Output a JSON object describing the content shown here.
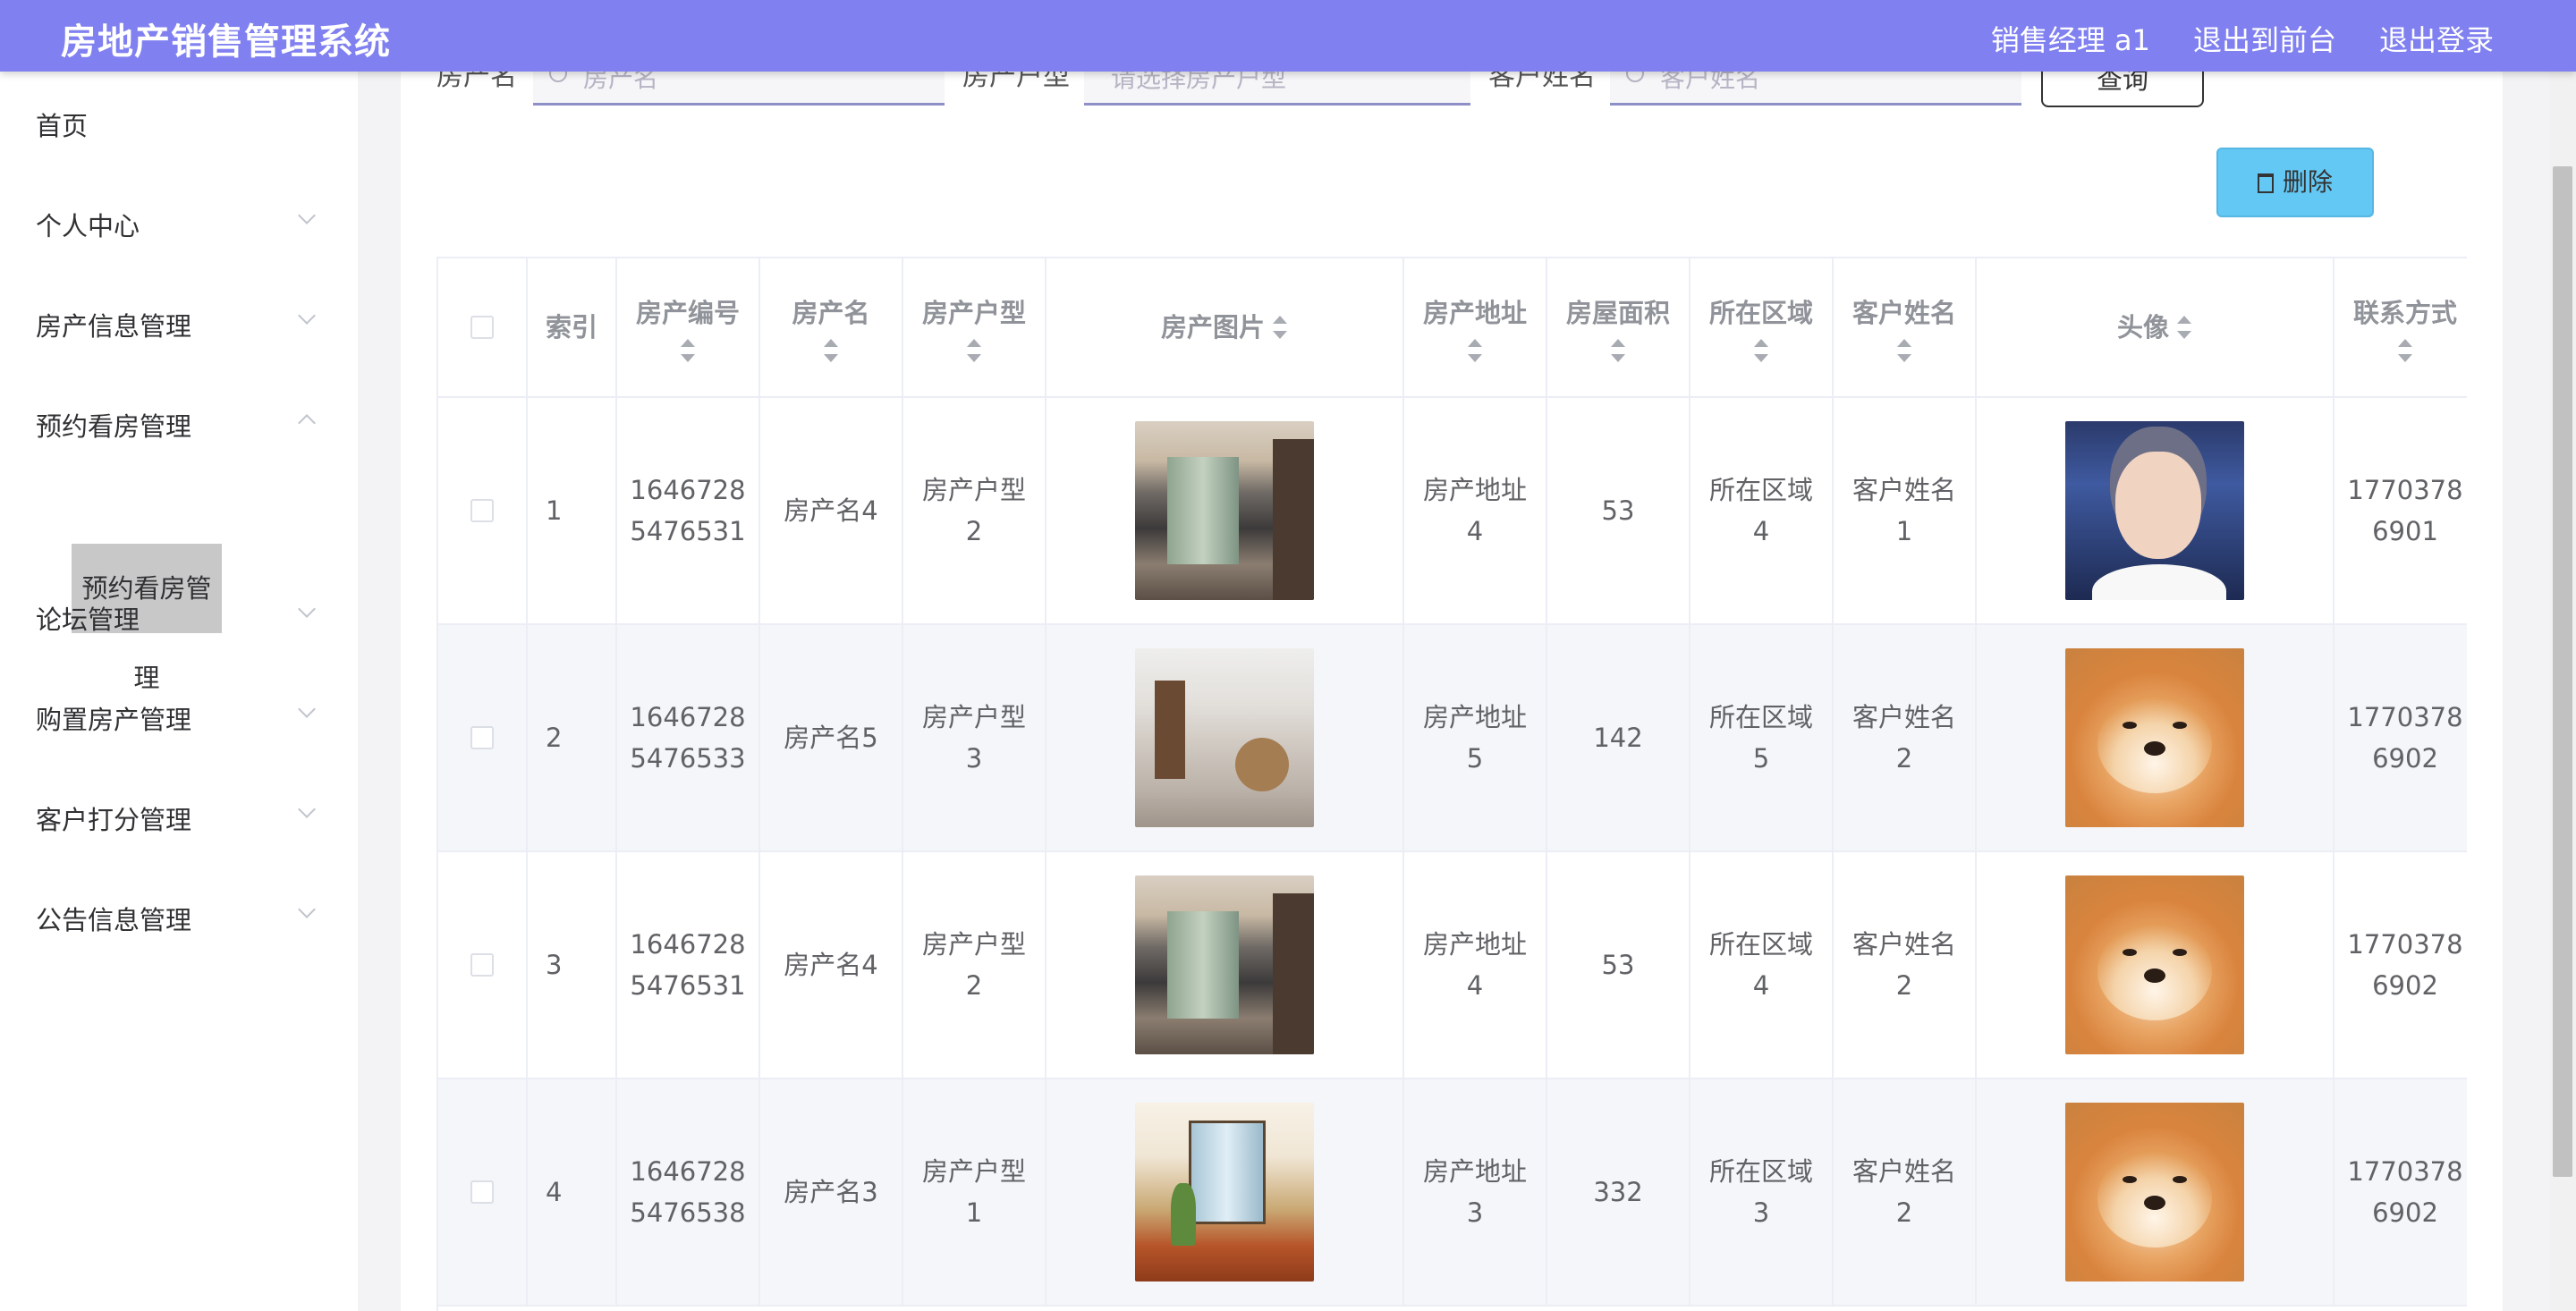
{
  "app": {
    "title": "房地产销售管理系统",
    "user_label": "销售经理 a1",
    "to_front": "退出到前台",
    "logout": "退出登录"
  },
  "sidebar": {
    "items": [
      {
        "label": "首页"
      },
      {
        "label": "个人中心"
      },
      {
        "label": "房产信息管理"
      },
      {
        "label": "预约看房管理"
      },
      {
        "label": "论坛管理"
      },
      {
        "label": "购置房产管理"
      },
      {
        "label": "客户打分管理"
      },
      {
        "label": "公告信息管理"
      }
    ],
    "active_sub": "预约看房管理"
  },
  "search": {
    "f1_label": "房产名",
    "f1_placeholder": "房产名",
    "f2_label": "房产户型",
    "f2_placeholder": "请选择房产户型",
    "f3_label": "客户姓名",
    "f3_placeholder": "客户姓名",
    "query_label": "查询"
  },
  "toolbar": {
    "delete_label": "删除"
  },
  "table": {
    "columns": [
      "索引",
      "房产编号",
      "房产名",
      "房产户型",
      "房产图片",
      "房产地址",
      "房屋面积",
      "所在区域",
      "客户姓名",
      "头像",
      "联系方式"
    ],
    "rows": [
      {
        "index": "1",
        "code_a": "1646728",
        "code_b": "5476531",
        "name": "房产名4",
        "type_a": "房产户型",
        "type_b": "2",
        "photo": "living-room",
        "addr_a": "房产地址",
        "addr_b": "4",
        "area": "53",
        "region_a": "所在区域",
        "region_b": "4",
        "cust_a": "客户姓名",
        "cust_b": "1",
        "avatar": "boy-portrait",
        "phone_a": "1770378",
        "phone_b": "6901"
      },
      {
        "index": "2",
        "code_a": "1646728",
        "code_b": "5476533",
        "name": "房产名5",
        "type_a": "房产户型",
        "type_b": "3",
        "photo": "bright-living-room",
        "addr_a": "房产地址",
        "addr_b": "5",
        "area": "142",
        "region_a": "所在区域",
        "region_b": "5",
        "cust_a": "客户姓名",
        "cust_b": "2",
        "avatar": "shiba-dog",
        "phone_a": "1770378",
        "phone_b": "6902"
      },
      {
        "index": "3",
        "code_a": "1646728",
        "code_b": "5476531",
        "name": "房产名4",
        "type_a": "房产户型",
        "type_b": "2",
        "photo": "living-room",
        "addr_a": "房产地址",
        "addr_b": "4",
        "area": "53",
        "region_a": "所在区域",
        "region_b": "4",
        "cust_a": "客户姓名",
        "cust_b": "2",
        "avatar": "shiba-dog",
        "phone_a": "1770378",
        "phone_b": "6902"
      },
      {
        "index": "4",
        "code_a": "1646728",
        "code_b": "5476538",
        "name": "房产名3",
        "type_a": "房产户型",
        "type_b": "1",
        "photo": "wood-floor-room",
        "addr_a": "房产地址",
        "addr_b": "3",
        "area": "332",
        "region_a": "所在区域",
        "region_b": "3",
        "cust_a": "客户姓名",
        "cust_b": "2",
        "avatar": "shiba-dog",
        "phone_a": "1770378",
        "phone_b": "6902"
      }
    ]
  },
  "colors": {
    "topbar": "#8080f0",
    "delete_button": "#64c8f4",
    "active_submenu": "#c8c8c8"
  }
}
